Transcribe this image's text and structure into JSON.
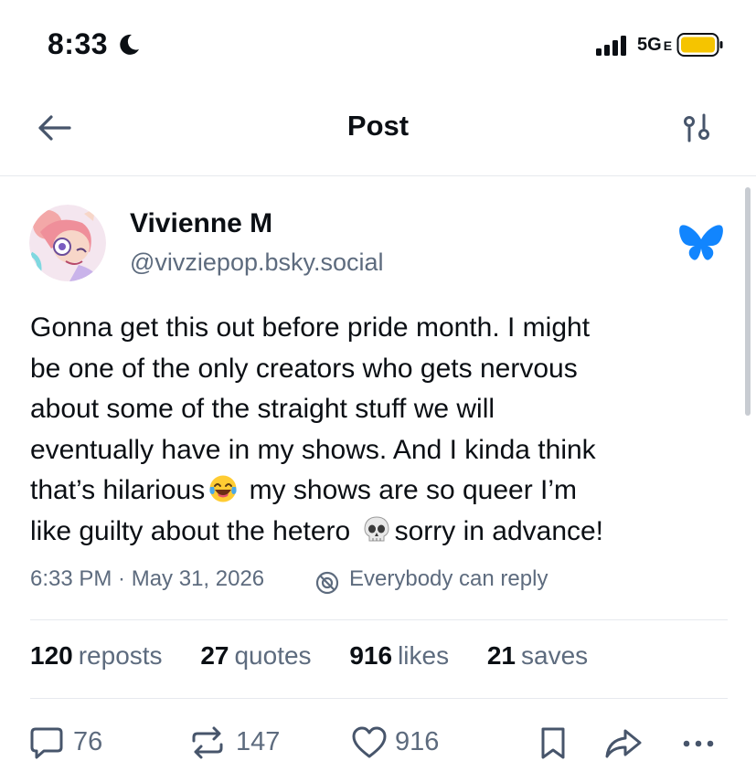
{
  "status_bar": {
    "time": "8:33",
    "network": "5G",
    "network_suffix": "E",
    "icons": [
      "moon-icon",
      "signal-icon",
      "battery-icon"
    ],
    "battery_color": "#f5c400"
  },
  "header": {
    "title": "Post",
    "icons": [
      "back-arrow-icon",
      "filter-icon"
    ]
  },
  "post": {
    "author": {
      "display_name": "Vivienne M",
      "handle": "@vivziepop.bsky.social"
    },
    "brand_icon": "butterfly-icon",
    "brand_color": "#1185fe",
    "text_lines": [
      "Gonna get this out before pride month. I might",
      "be one of the only creators who gets nervous",
      "about some of the straight stuff we will",
      "eventually have in my shows. And I kinda think",
      "that’s hilarious",
      " my shows are so queer I’m",
      "like guilty about the hetero",
      "sorry in advance!"
    ],
    "emojis": [
      "laughing-tears-emoji",
      "skull-emoji"
    ],
    "timestamp": "6:33 PM · May 31, 2026",
    "reply_setting": "Everybody can reply",
    "stats": {
      "reposts_count": "120",
      "reposts_label": "reposts",
      "quotes_count": "27",
      "quotes_label": "quotes",
      "likes_count": "916",
      "likes_label": "likes",
      "saves_count": "21",
      "saves_label": "saves"
    },
    "actions": {
      "reply_count": "76",
      "repost_count": "147",
      "like_count": "916",
      "icons": [
        "reply-icon",
        "repost-icon",
        "heart-icon",
        "bookmark-icon",
        "share-icon",
        "more-icon"
      ]
    }
  },
  "colors": {
    "text": "#0b0f14",
    "muted": "#5d6b7e",
    "divider": "#e6e9ee"
  }
}
